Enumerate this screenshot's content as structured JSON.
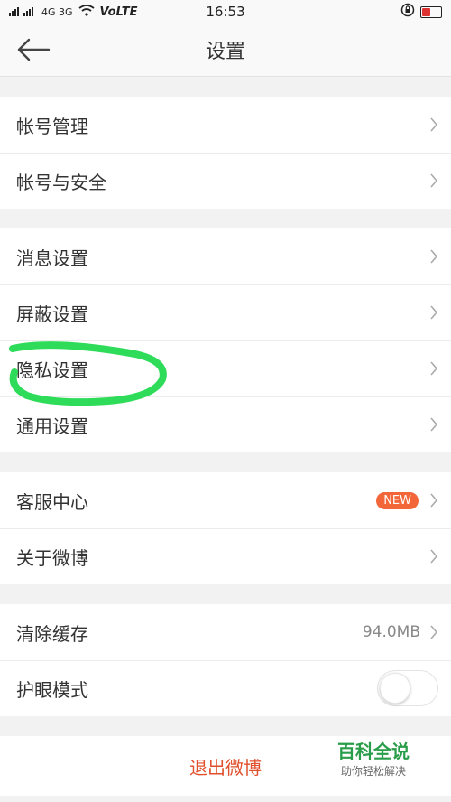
{
  "status_bar": {
    "network": "4G 3G",
    "volte": "VoLTE",
    "time": "16:53"
  },
  "nav": {
    "title": "设置"
  },
  "groups": [
    {
      "items": [
        {
          "label": "帐号管理"
        },
        {
          "label": "帐号与安全"
        }
      ]
    },
    {
      "items": [
        {
          "label": "消息设置"
        },
        {
          "label": "屏蔽设置"
        },
        {
          "label": "隐私设置"
        },
        {
          "label": "通用设置"
        }
      ]
    },
    {
      "items": [
        {
          "label": "客服中心",
          "badge": "NEW"
        },
        {
          "label": "关于微博"
        }
      ]
    },
    {
      "items": [
        {
          "label": "清除缓存",
          "value": "94.0MB"
        },
        {
          "label": "护眼模式",
          "toggle": false
        }
      ]
    }
  ],
  "logout": {
    "label": "退出微博"
  },
  "watermark": {
    "title": "百科全说",
    "subtitle": "助你轻松解决"
  },
  "colors": {
    "accent": "#e0502c",
    "badge": "#f2663a",
    "annotation": "#2edc5a"
  }
}
